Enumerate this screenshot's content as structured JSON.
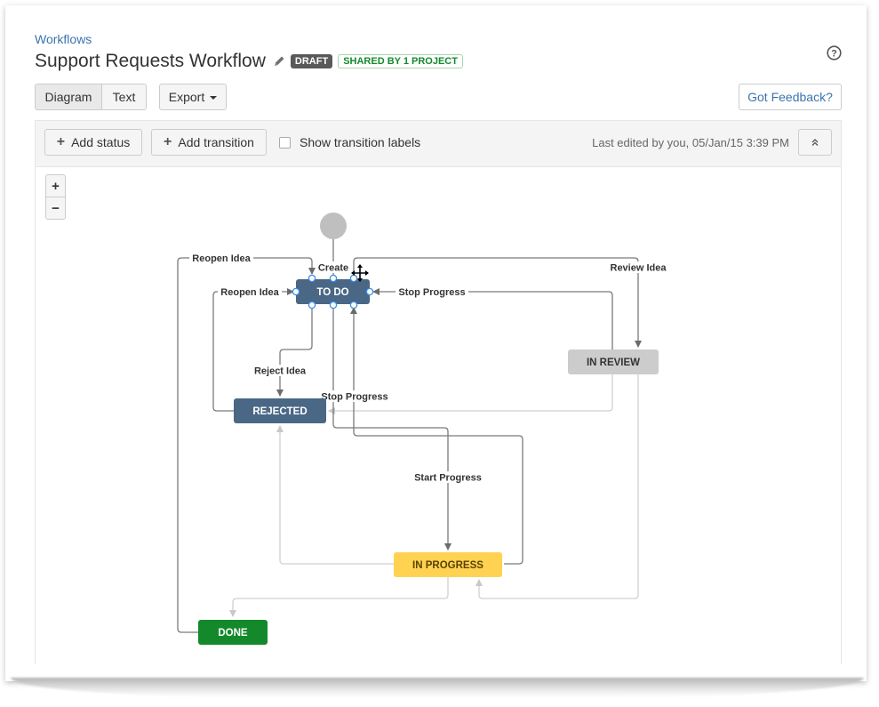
{
  "header": {
    "breadcrumb": "Workflows",
    "title": "Support Requests Workflow",
    "draft_badge": "DRAFT",
    "shared_badge": "SHARED BY 1 PROJECT",
    "help_icon": "question-circle-icon"
  },
  "view_toggle": {
    "diagram_label": "Diagram",
    "text_label": "Text",
    "selected": "Diagram"
  },
  "export_label": "Export",
  "feedback_label": "Got Feedback?",
  "toolbar": {
    "add_status_label": "Add status",
    "add_transition_label": "Add transition",
    "show_labels_label": "Show transition labels",
    "show_labels_checked": false,
    "last_edited": "Last edited by you, 05/Jan/15 3:39 PM",
    "collapse_icon": "double-chevron-up-icon"
  },
  "zoom_controls": {
    "zoom_in": "+",
    "zoom_out": "−"
  },
  "diagram": {
    "statuses": [
      {
        "id": "todo",
        "label": "TO DO",
        "color": "#4a6785",
        "text_color": "#ffffff",
        "selected": true
      },
      {
        "id": "inreview",
        "label": "IN REVIEW",
        "color": "#cccccc",
        "text_color": "#333333",
        "selected": false
      },
      {
        "id": "rejected",
        "label": "REJECTED",
        "color": "#4a6785",
        "text_color": "#ffffff",
        "selected": false
      },
      {
        "id": "inprogress",
        "label": "IN PROGRESS",
        "color": "#ffd351",
        "text_color": "#594300",
        "selected": false
      },
      {
        "id": "done",
        "label": "DONE",
        "color": "#14892c",
        "text_color": "#ffffff",
        "selected": false
      }
    ],
    "transitions": [
      {
        "label": "Create",
        "from": "start",
        "to": "todo"
      },
      {
        "label": "Reopen Idea",
        "from": "done",
        "to": "todo"
      },
      {
        "label": "Reopen Idea",
        "from": "rejected",
        "to": "todo"
      },
      {
        "label": "Review Idea",
        "from": "todo",
        "to": "inreview"
      },
      {
        "label": "Stop Progress",
        "from": "inreview",
        "to": "todo"
      },
      {
        "label": "Reject Idea",
        "from": "todo",
        "to": "rejected"
      },
      {
        "label": "Stop Progress",
        "from": "inprogress",
        "to": "todo"
      },
      {
        "label": "Start Progress",
        "from": "todo",
        "to": "inprogress"
      },
      {
        "label": "",
        "from": "inreview",
        "to": "rejected"
      },
      {
        "label": "",
        "from": "inprogress",
        "to": "rejected"
      },
      {
        "label": "",
        "from": "inprogress",
        "to": "done"
      },
      {
        "label": "",
        "from": "inreview",
        "to": "inprogress"
      }
    ]
  }
}
